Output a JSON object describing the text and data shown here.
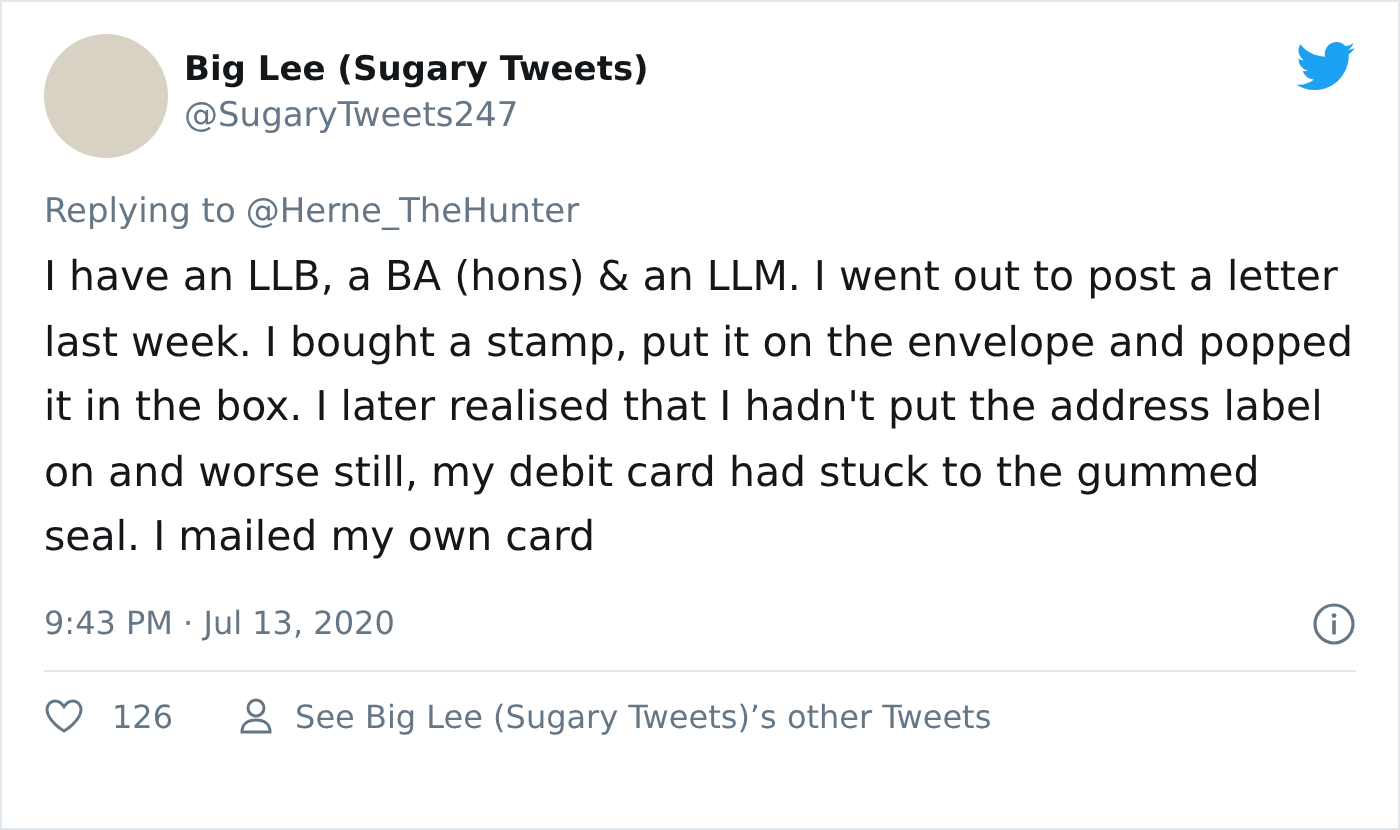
{
  "author": {
    "name": "Big Lee (Sugary Tweets)",
    "handle": "@SugaryTweets247"
  },
  "reply": {
    "prefix": "Replying to",
    "mention": "@Herne_TheHunter"
  },
  "body": "I have an LLB, a BA (hons) & an LLM. I went out to post a letter last week. I bought a stamp, put it on the envelope and popped it in the box. I later realised that I hadn't put the address label on and worse still, my debit card had stuck to the gummed seal. I mailed my own card",
  "timestamp": "9:43 PM · Jul 13, 2020",
  "likes": "126",
  "more_link": "See Big Lee (Sugary Tweets)’s other Tweets"
}
